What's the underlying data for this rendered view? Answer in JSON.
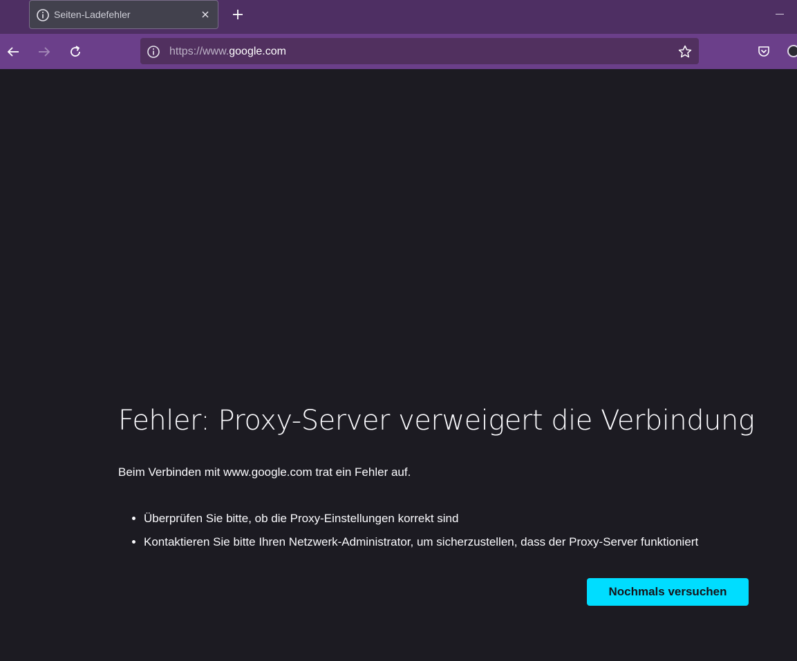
{
  "tab": {
    "title": "Seiten-Ladefehler",
    "icon": "info-icon"
  },
  "urlbar": {
    "url_prefix": "https://www.",
    "url_domain": "google.com",
    "icon": "info-icon"
  },
  "error": {
    "title": "Fehler: Proxy-Server verweigert die Verbindung",
    "description": "Beim Verbinden mit www.google.com trat ein Fehler auf.",
    "suggestions": [
      "Überprüfen Sie bitte, ob die Proxy-Einstellungen korrekt sind",
      "Kontaktieren Sie bitte Ihren Netzwerk-Administrator, um sicherzustellen, dass der Proxy-Server funktioniert"
    ],
    "retry_label": "Nochmals versuchen"
  },
  "colors": {
    "tabbar": "#4e2f63",
    "navbar": "#6b3f8a",
    "content_bg": "#1c1b22",
    "button_accent": "#00ddff"
  }
}
